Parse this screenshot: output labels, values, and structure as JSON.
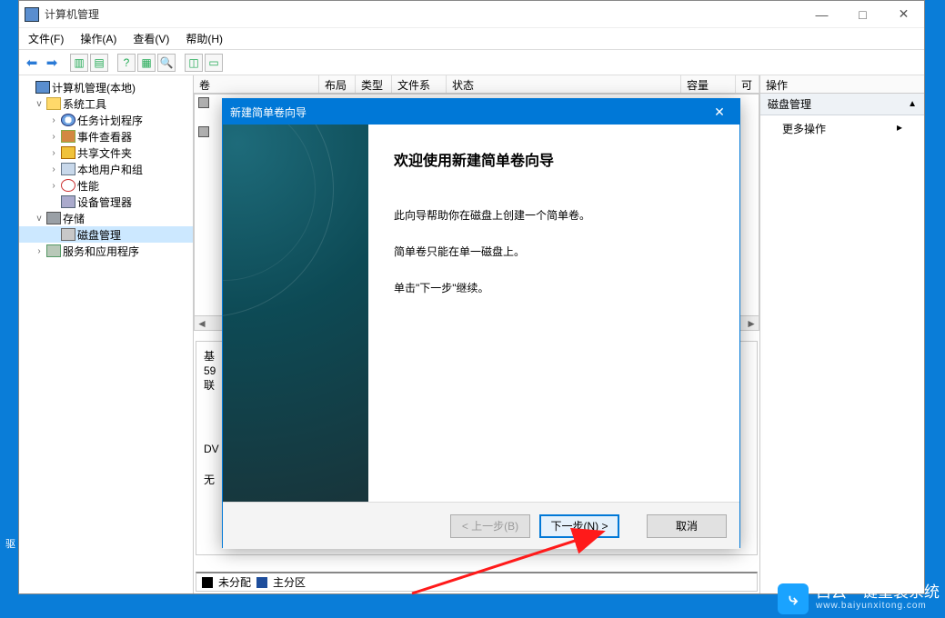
{
  "window": {
    "title": "计算机管理",
    "menus": {
      "file": "文件(F)",
      "action": "操作(A)",
      "view": "查看(V)",
      "help": "帮助(H)"
    },
    "win_min": "—",
    "win_max": "□",
    "win_close": "✕"
  },
  "tree": {
    "root": "计算机管理(本地)",
    "sys_tools": "系统工具",
    "task_sched": "任务计划程序",
    "event_viewer": "事件查看器",
    "shared": "共享文件夹",
    "local_users": "本地用户和组",
    "perf": "性能",
    "dev_mgr": "设备管理器",
    "storage": "存储",
    "disk_mgmt": "磁盘管理",
    "svc_apps": "服务和应用程序"
  },
  "vol_headers": {
    "vol": "卷",
    "layout": "布局",
    "type": "类型",
    "fs": "文件系统",
    "status": "状态",
    "capacity": "容量",
    "avail": "可"
  },
  "disk_list_rows": [
    "",
    ""
  ],
  "hscroll": {
    "left": "◄",
    "right": "►"
  },
  "disk_block": {
    "l1": "基",
    "l2": "59",
    "l3": "联",
    "dvd": "DV",
    "none": "无"
  },
  "legend": {
    "unalloc": "未分配",
    "primary": "主分区"
  },
  "actions": {
    "header": "操作",
    "group": "磁盘管理",
    "more": "更多操作",
    "caret": "▸",
    "chev": "▲"
  },
  "dialog": {
    "title": "新建简单卷向导",
    "heading": "欢迎使用新建简单卷向导",
    "p1": "此向导帮助你在磁盘上创建一个简单卷。",
    "p2": "简单卷只能在单一磁盘上。",
    "p3": "单击\"下一步\"继续。",
    "back": "< 上一步(B)",
    "next": "下一步(N) >",
    "cancel": "取消",
    "close": "✕"
  },
  "desktop": {
    "line1": "",
    "driver": "驱"
  },
  "watermark": {
    "badge": "⤷",
    "main": "白云一键重装系统",
    "sub": "www.baiyunxitong.com"
  }
}
